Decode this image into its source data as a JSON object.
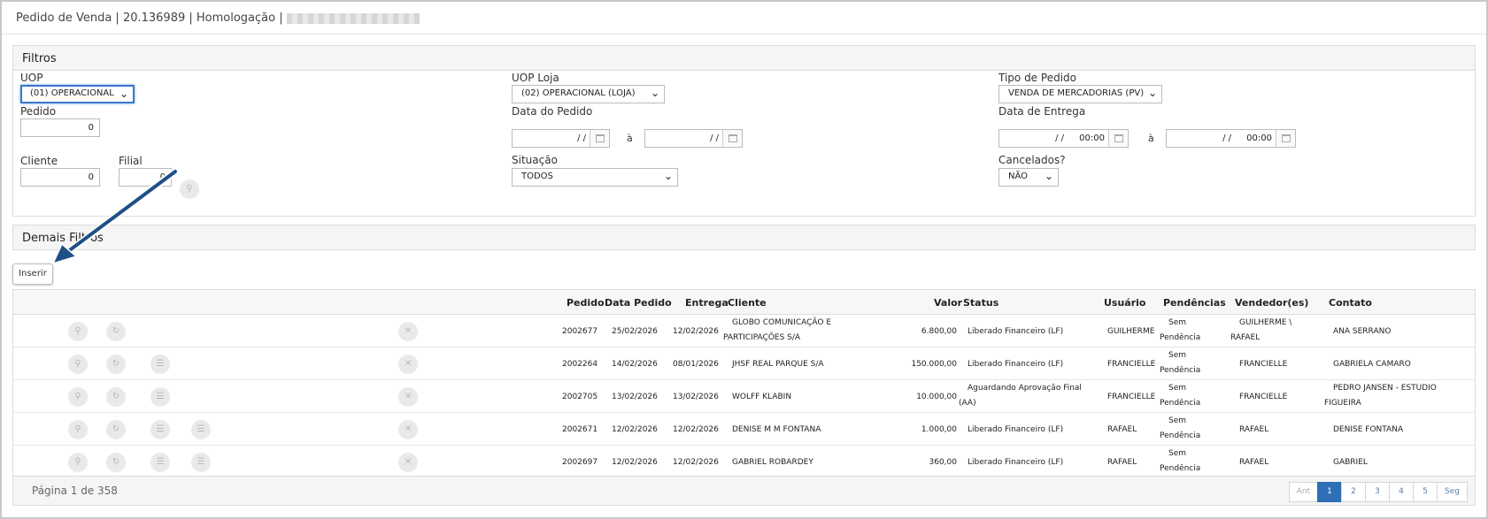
{
  "header": {
    "title": "Pedido de Venda | 20.136989 | Homologação |",
    "redacted_suffix": "_"
  },
  "filtros": {
    "heading": "Filtros",
    "uop": {
      "label": "UOP",
      "value": "(01) OPERACIONAL"
    },
    "uop_loja": {
      "label": "UOP Loja",
      "value": "(02) OPERACIONAL (LOJA)"
    },
    "tipo_pedido": {
      "label": "Tipo de Pedido",
      "value": "VENDA DE MERCADORIAS (PV)"
    },
    "pedido": {
      "label": "Pedido",
      "value": "0"
    },
    "data_pedido": {
      "label": "Data do Pedido",
      "from": "/ /",
      "separator": "à",
      "to": "/ /"
    },
    "data_entrega": {
      "label": "Data de Entrega",
      "from": "/ /",
      "from_time": "00:00",
      "separator": "à",
      "to": "/ /",
      "to_time": "00:00"
    },
    "cliente": {
      "label": "Cliente",
      "value": "0"
    },
    "filial": {
      "label": "Filial",
      "value": "0"
    },
    "situacao": {
      "label": "Situação",
      "value": "TODOS"
    },
    "cancelados": {
      "label": "Cancelados?",
      "value": "NÃO"
    }
  },
  "demais_filtros": {
    "heading": "Demais Filtros"
  },
  "toolbar": {
    "inserir_label": "Inserir"
  },
  "table": {
    "columns": {
      "pedido": "Pedido",
      "data_pedido": "Data Pedido",
      "entrega": "Entrega",
      "cliente": "Cliente",
      "valor": "Valor",
      "status": "Status",
      "usuario": "Usuário",
      "pendencias": "Pendências",
      "vendedores": "Vendedor(es)",
      "contato": "Contato"
    },
    "rows": [
      {
        "pedido": "2002677",
        "data_pedido": "25/02/2026",
        "entrega": "12/02/2026",
        "cliente": "GLOBO COMUNICAÇÃO E PARTICIPAÇÕES S/A",
        "valor": "6.800,00",
        "status": "Liberado Financeiro (LF)",
        "usuario": "GUILHERME",
        "pendencias": "Sem Pendência",
        "vendedores": "GUILHERME \\ RAFAEL",
        "contato": "ANA SERRANO"
      },
      {
        "pedido": "2002264",
        "data_pedido": "14/02/2026",
        "entrega": "08/01/2026",
        "cliente": "JHSF REAL PARQUE S/A",
        "valor": "150.000,00",
        "status": "Liberado Financeiro (LF)",
        "usuario": "FRANCIELLE",
        "pendencias": "Sem Pendência",
        "vendedores": "FRANCIELLE",
        "contato": "GABRIELA CAMARO"
      },
      {
        "pedido": "2002705",
        "data_pedido": "13/02/2026",
        "entrega": "13/02/2026",
        "cliente": "WOLFF KLABIN",
        "valor": "10.000,00",
        "status": "Aguardando Aprovação Final (AA)",
        "usuario": "FRANCIELLE",
        "pendencias": "Sem Pendência",
        "vendedores": "FRANCIELLE",
        "contato": "PEDRO JANSEN - ESTUDIO FIGUEIRA"
      },
      {
        "pedido": "2002671",
        "data_pedido": "12/02/2026",
        "entrega": "12/02/2026",
        "cliente": "DENISE M M FONTANA",
        "valor": "1.000,00",
        "status": "Liberado Financeiro (LF)",
        "usuario": "RAFAEL",
        "pendencias": "Sem Pendência",
        "vendedores": "RAFAEL",
        "contato": "DENISE FONTANA"
      },
      {
        "pedido": "2002697",
        "data_pedido": "12/02/2026",
        "entrega": "12/02/2026",
        "cliente": "GABRIEL ROBARDEY",
        "valor": "360,00",
        "status": "Liberado Financeiro (LF)",
        "usuario": "RAFAEL",
        "pendencias": "Sem Pendência",
        "vendedores": "RAFAEL",
        "contato": "GABRIEL"
      }
    ]
  },
  "pagination": {
    "info": "Página 1 de 358",
    "prev": "Ant",
    "p1": "1",
    "p2": "2",
    "p3": "3",
    "p4": "4",
    "p5": "5",
    "next": "Seg"
  },
  "icons": {
    "view": "search-icon",
    "history": "history-icon",
    "list": "list-icon",
    "cancel": "close-icon",
    "calendar": "calendar-icon",
    "arrow": "annotation-arrow"
  },
  "colors": {
    "accent": "#2f6fb5",
    "arrow": "#1f4f86",
    "focus": "#3a78c8"
  }
}
